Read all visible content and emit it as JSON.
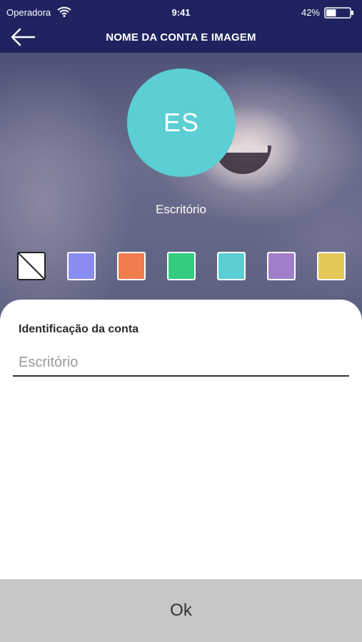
{
  "status_bar": {
    "carrier": "Operadora",
    "time": "9:41",
    "battery": "42%",
    "battery_level": 0.42
  },
  "nav": {
    "title": "NOME DA CONTA E IMAGEM",
    "back_icon": "arrow-left-icon"
  },
  "avatar": {
    "initials": "ES",
    "color": "#5bcfd3"
  },
  "account_name": "Escritório",
  "color_options": [
    {
      "id": "none",
      "color": "none"
    },
    {
      "id": "blue",
      "color": "#8b8cf2"
    },
    {
      "id": "orange",
      "color": "#ef7d4e"
    },
    {
      "id": "green",
      "color": "#34cc7e"
    },
    {
      "id": "teal",
      "color": "#5bcfd3"
    },
    {
      "id": "purple",
      "color": "#a07ec8"
    },
    {
      "id": "yellow",
      "color": "#e5c858"
    }
  ],
  "form": {
    "label": "Identificação da conta",
    "placeholder": "Escritório",
    "value": ""
  },
  "ok_button": "Ok"
}
